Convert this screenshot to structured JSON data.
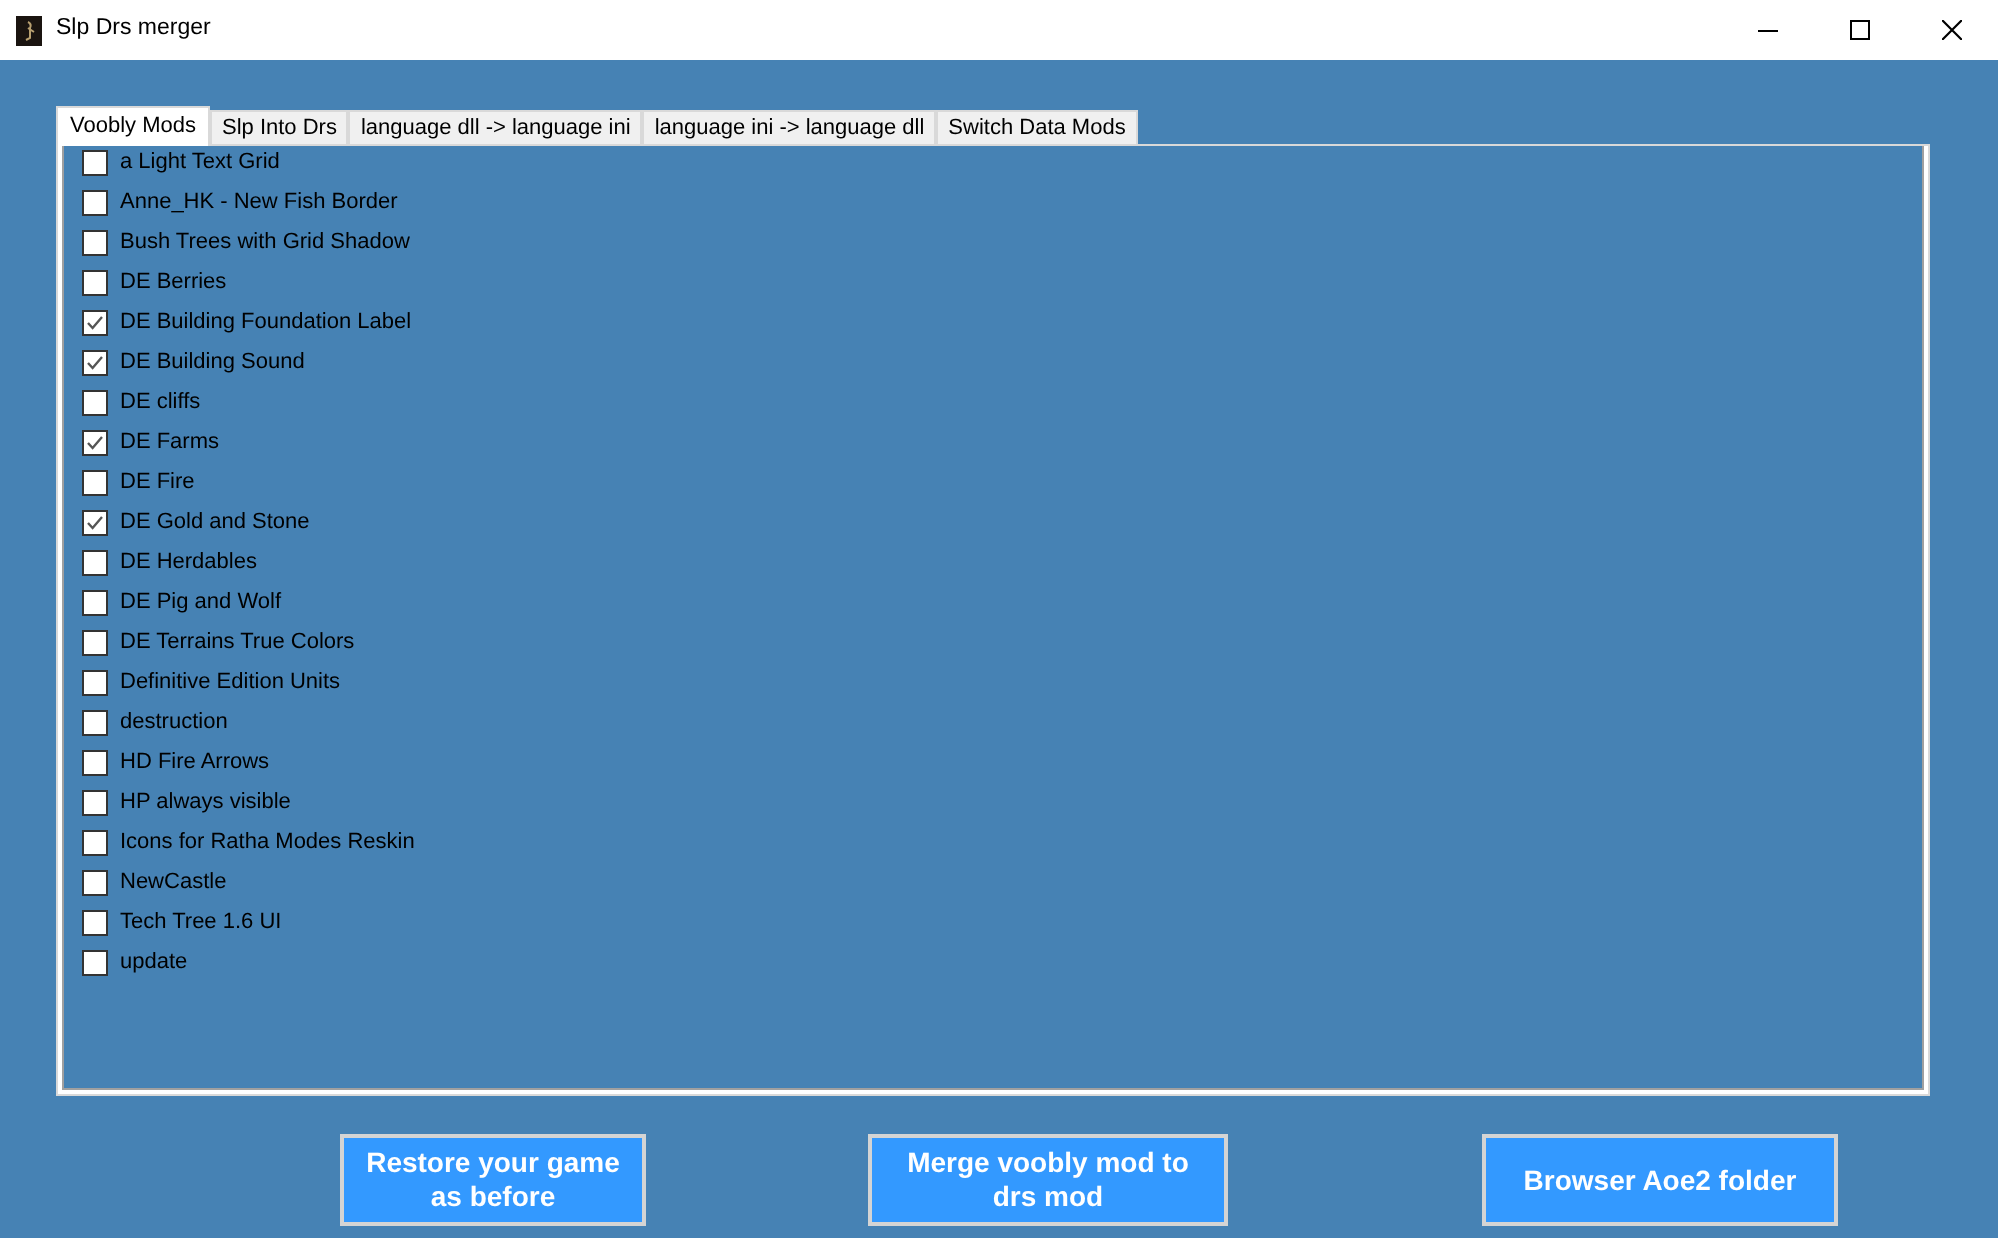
{
  "window": {
    "title": "Slp Drs merger"
  },
  "tabs": [
    {
      "label": "Voobly Mods",
      "selected": true
    },
    {
      "label": "Slp Into Drs",
      "selected": false
    },
    {
      "label": "language dll -> language ini",
      "selected": false
    },
    {
      "label": "language ini -> language dll",
      "selected": false
    },
    {
      "label": "Switch Data Mods",
      "selected": false
    }
  ],
  "mods": [
    {
      "label": "a Light Text Grid",
      "checked": false
    },
    {
      "label": "Anne_HK - New Fish Border",
      "checked": false
    },
    {
      "label": "Bush Trees with Grid Shadow",
      "checked": false
    },
    {
      "label": "DE Berries",
      "checked": false
    },
    {
      "label": "DE Building Foundation Label",
      "checked": true
    },
    {
      "label": "DE Building Sound",
      "checked": true
    },
    {
      "label": "DE cliffs",
      "checked": false
    },
    {
      "label": "DE Farms",
      "checked": true
    },
    {
      "label": "DE Fire",
      "checked": false
    },
    {
      "label": "DE Gold and Stone",
      "checked": true
    },
    {
      "label": "DE Herdables",
      "checked": false
    },
    {
      "label": "DE Pig and Wolf",
      "checked": false
    },
    {
      "label": "DE Terrains True Colors",
      "checked": false
    },
    {
      "label": "Definitive Edition Units",
      "checked": false
    },
    {
      "label": "destruction",
      "checked": false
    },
    {
      "label": "HD Fire Arrows",
      "checked": false
    },
    {
      "label": "HP always visible",
      "checked": false
    },
    {
      "label": "Icons for Ratha Modes Reskin",
      "checked": false
    },
    {
      "label": "NewCastle",
      "checked": false
    },
    {
      "label": "Tech Tree 1.6 UI",
      "checked": false
    },
    {
      "label": "update",
      "checked": false
    }
  ],
  "buttons": [
    "Restore your game as before",
    "Merge voobly mod to drs mod",
    "Browser Aoe2 folder"
  ]
}
